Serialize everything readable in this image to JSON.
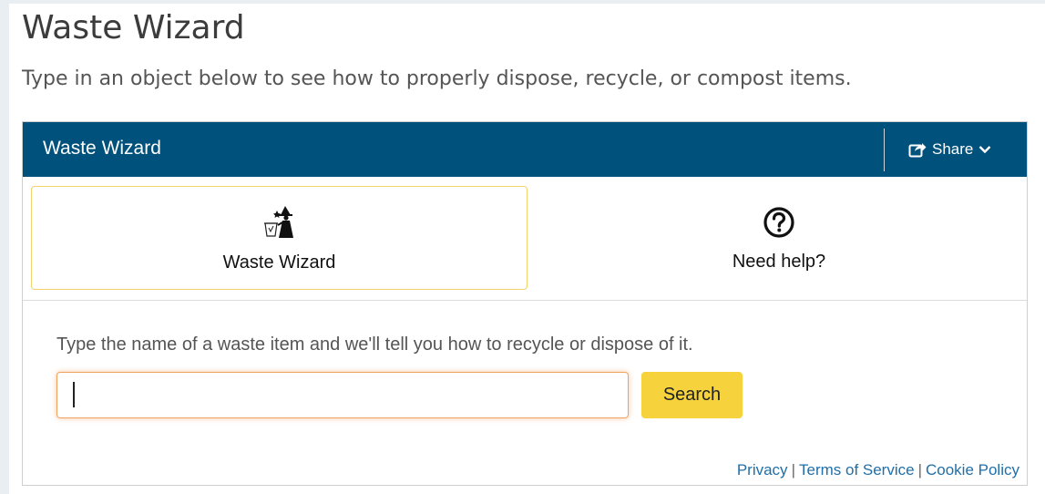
{
  "page": {
    "title": "Waste Wizard",
    "subtitle": "Type in an object below to see how to properly dispose, recycle, or compost items."
  },
  "widget": {
    "header_title": "Waste Wizard",
    "share_label": "Share",
    "header_color": "#00517c",
    "tabs": [
      {
        "label": "Waste Wizard",
        "icon": "wizard-icon",
        "active": true
      },
      {
        "label": "Need help?",
        "icon": "question-circle-icon",
        "active": false
      }
    ],
    "prompt": "Type the name of a waste item and we'll tell you how to recycle or dispose of it.",
    "search": {
      "value": "",
      "placeholder": "",
      "button_label": "Search",
      "button_color": "#f6d33c"
    },
    "footer": {
      "privacy": "Privacy",
      "terms": "Terms of Service",
      "cookie": "Cookie Policy",
      "separator": "|"
    }
  }
}
